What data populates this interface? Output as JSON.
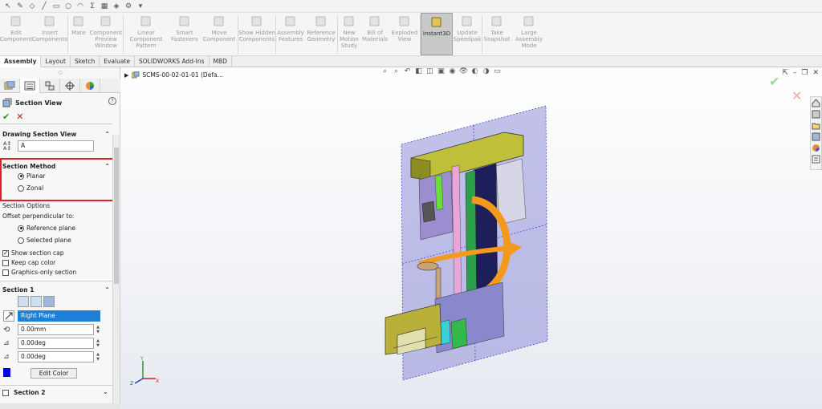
{
  "ribbon": {
    "buttons": [
      {
        "label": "Edit Component",
        "sel": false
      },
      {
        "label": "Insert Components",
        "sel": false
      },
      {
        "label": "Mate",
        "sel": false
      },
      {
        "label": "Component Preview Window",
        "sel": false
      },
      {
        "label": "Linear Component Pattern",
        "sel": false
      },
      {
        "label": "Smart Fasteners",
        "sel": false
      },
      {
        "label": "Move Component",
        "sel": false
      },
      {
        "label": "Show Hidden Components",
        "sel": false
      },
      {
        "label": "Assembly Features",
        "sel": false
      },
      {
        "label": "Reference Geometry",
        "sel": false
      },
      {
        "label": "New Motion Study",
        "sel": false
      },
      {
        "label": "Bill of Materials",
        "sel": false
      },
      {
        "label": "Exploded View",
        "sel": false
      },
      {
        "label": "Instant3D",
        "sel": true
      },
      {
        "label": "Update Speedpak",
        "sel": false
      },
      {
        "label": "Take Snapshot",
        "sel": false
      },
      {
        "label": "Large Assembly Mode",
        "sel": false
      }
    ]
  },
  "tabs": [
    "Assembly",
    "Layout",
    "Sketch",
    "Evaluate",
    "SOLIDWORKS Add-Ins",
    "MBD"
  ],
  "active_tab": "Assembly",
  "property_manager": {
    "title": "Section View",
    "help": "?",
    "drawing_section_view": {
      "label": "Drawing Section View",
      "name_value": "A"
    },
    "section_method": {
      "label": "Section Method",
      "options": [
        "Planar",
        "Zonal"
      ],
      "selected": "Planar"
    },
    "section_options": {
      "label": "Section Options",
      "offset_label": "Offset perpendicular to:",
      "options": [
        "Reference plane",
        "Selected plane"
      ],
      "selected": "Reference plane",
      "checks": [
        {
          "label": "Show section cap",
          "checked": true
        },
        {
          "label": "Keep cap color",
          "checked": false
        },
        {
          "label": "Graphics-only section",
          "checked": false
        }
      ]
    },
    "section1": {
      "label": "Section 1",
      "plane": "Right Plane",
      "offset": "0.00mm",
      "angle1": "0.00deg",
      "angle2": "0.00deg",
      "edit_color": "Edit Color"
    },
    "section2": {
      "label": "Section 2"
    }
  },
  "tree": {
    "item": "SCMS-00-02-01-01  (Defa..."
  },
  "triad": {
    "x": "X",
    "y": "Y",
    "z": "Z"
  },
  "colors": {
    "accent_red": "#e51d24",
    "section_plane": "#8f8fd8",
    "ok_green": "#1a9a1a",
    "cancel_red": "#c41e1e",
    "highlight_blue": "#1e7fd6"
  }
}
